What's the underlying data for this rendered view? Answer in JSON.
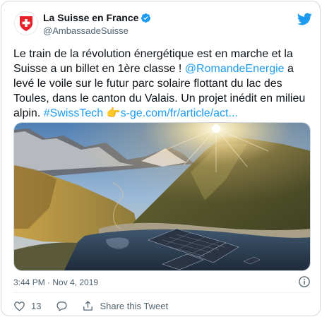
{
  "author": {
    "display_name": "La Suisse en France",
    "handle": "@AmbassadeSuisse",
    "verified": true,
    "avatar_icon": "swiss-flag-icon"
  },
  "tweet": {
    "segments": [
      {
        "text": "Le train de la révolution énergétique est en marche et la Suisse a un billet en 1ère classe ! ",
        "link": false
      },
      {
        "text": "@RomandeEnergie",
        "link": true
      },
      {
        "text": " a levé le voile sur le futur parc solaire flottant du lac des Toules, dans le canton du Valais. Un projet inédit en milieu alpin. ",
        "link": false
      },
      {
        "text": "#SwissTech",
        "link": true
      },
      {
        "text": " 👉",
        "link": false
      },
      {
        "text": "s-ge.com/fr/article/act...",
        "link": true
      }
    ],
    "timestamp": "3:44 PM · Nov 4, 2019",
    "likes": "13",
    "share_label": "Share this Tweet"
  },
  "colors": {
    "link": "#1d9bf0",
    "swiss_red": "#e8202a",
    "twitter_blue": "#1d9bf0",
    "secondary_text": "#536471"
  }
}
